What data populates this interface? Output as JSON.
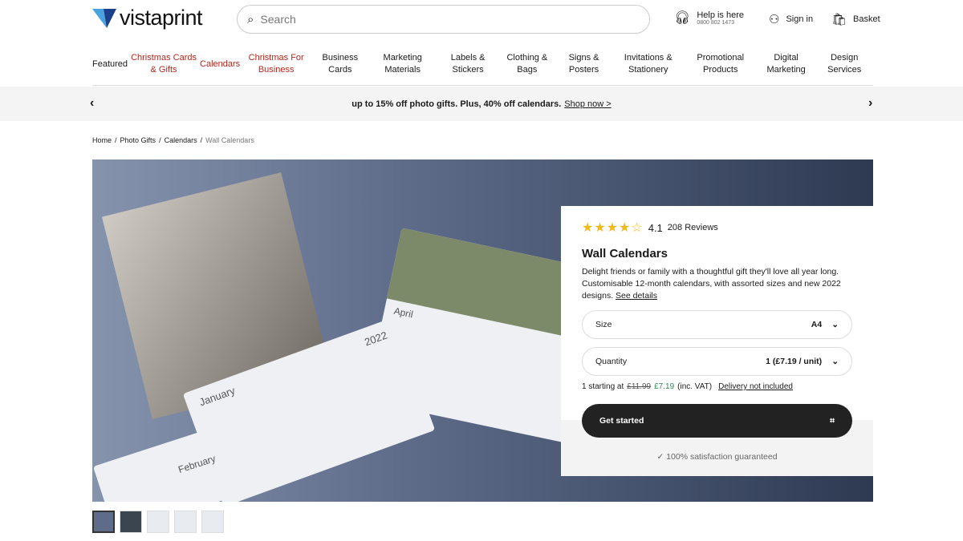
{
  "header": {
    "logo": "vistaprint",
    "search_placeholder": "Search",
    "help_title": "Help is here",
    "help_phone": "0800 802 1473",
    "sign_in": "Sign in",
    "basket": "Basket"
  },
  "nav": [
    {
      "label": "Featured",
      "red": false
    },
    {
      "label": "Christmas Cards & Gifts",
      "red": true
    },
    {
      "label": "Calendars",
      "red": true
    },
    {
      "label": "Christmas For Business",
      "red": true
    },
    {
      "label": "Business Cards"
    },
    {
      "label": "Marketing Materials"
    },
    {
      "label": "Labels & Stickers"
    },
    {
      "label": "Clothing & Bags"
    },
    {
      "label": "Signs & Posters"
    },
    {
      "label": "Invitations & Stationery"
    },
    {
      "label": "Promotional Products"
    },
    {
      "label": "Digital Marketing"
    },
    {
      "label": "Design Services"
    }
  ],
  "promo": {
    "text": "up to 15% off photo gifts. Plus, 40% off calendars.",
    "link": "Shop now >"
  },
  "breadcrumb": [
    "Home",
    "Photo Gifts",
    "Calendars",
    "Wall Calendars"
  ],
  "product": {
    "rating": 4.1,
    "stars_text": "★★★★☆",
    "rating_label": "4.1",
    "reviews": "208 Reviews",
    "title": "Wall Calendars",
    "description": "Delight friends or family with a thoughtful gift they'll love all year long. Customisable 12-month calendars, with assorted sizes and new 2022 designs.",
    "see_details": "See details",
    "size_label": "Size",
    "size_value": "A4",
    "quantity_label": "Quantity",
    "quantity_value": "1 (£7.19 / unit)",
    "price_prefix": "1 starting at",
    "old_price": "£11.99",
    "new_price": "£7.19",
    "vat": "(inc. VAT)",
    "delivery": "Delivery not included",
    "cta": "Get started",
    "guarantee": "100% satisfaction guaranteed"
  },
  "hero_text": {
    "month1": "January",
    "month2": "April",
    "month3": "February",
    "year": "2022"
  },
  "colors": {
    "accent_red": "#b1291e",
    "price_green": "#2e8b57",
    "star": "#f2b81c",
    "cta": "#222222"
  }
}
